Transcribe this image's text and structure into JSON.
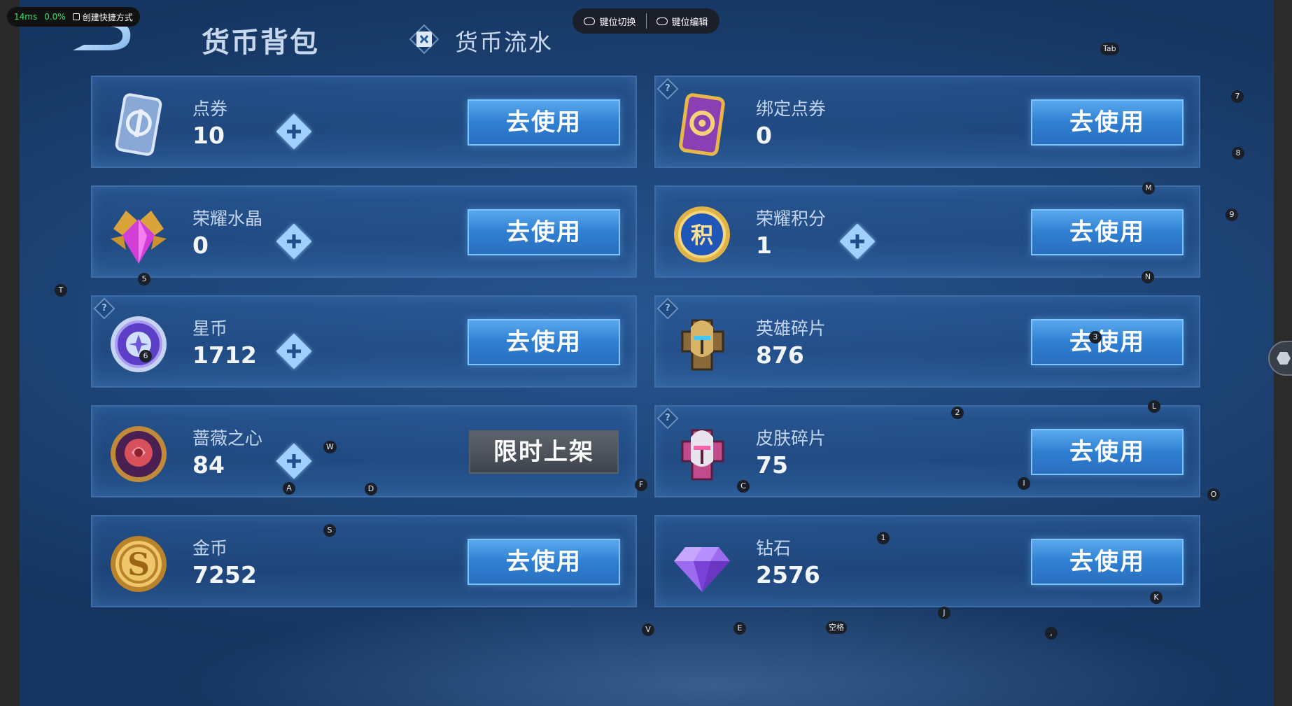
{
  "status_bar": {
    "ping": "14ms",
    "cpu": "0.0%",
    "shortcut_label": "创建快捷方式"
  },
  "key_toolbar": {
    "switch_label": "键位切换",
    "edit_label": "键位编辑"
  },
  "header": {
    "title": "货币背包",
    "flow_tab": "货币流水"
  },
  "colors": {
    "accent": "#2f7fd2",
    "panel": "#1d4476",
    "text_light": "#c4d5ee"
  },
  "currencies": [
    {
      "name": "点券",
      "amount": "10",
      "icon": "ticket-icon",
      "plus": true,
      "help": false,
      "action": "去使用",
      "action_type": "use"
    },
    {
      "name": "绑定点券",
      "amount": "0",
      "icon": "bound-ticket-icon",
      "plus": false,
      "help": true,
      "action": "去使用",
      "action_type": "use"
    },
    {
      "name": "荣耀水晶",
      "amount": "0",
      "icon": "glory-crystal-icon",
      "plus": true,
      "help": false,
      "action": "去使用",
      "action_type": "use"
    },
    {
      "name": "荣耀积分",
      "amount": "1",
      "icon": "glory-points-icon",
      "plus": true,
      "help": false,
      "action": "去使用",
      "action_type": "use"
    },
    {
      "name": "星币",
      "amount": "1712",
      "icon": "star-coin-icon",
      "plus": true,
      "help": true,
      "action": "去使用",
      "action_type": "use"
    },
    {
      "name": "英雄碎片",
      "amount": "876",
      "icon": "hero-shard-icon",
      "plus": false,
      "help": true,
      "action": "去使用",
      "action_type": "use"
    },
    {
      "name": "蔷薇之心",
      "amount": "84",
      "icon": "rose-heart-icon",
      "plus": true,
      "help": false,
      "action": "限时上架",
      "action_type": "limited"
    },
    {
      "name": "皮肤碎片",
      "amount": "75",
      "icon": "skin-shard-icon",
      "plus": false,
      "help": true,
      "action": "去使用",
      "action_type": "use"
    },
    {
      "name": "金币",
      "amount": "7252",
      "icon": "gold-coin-icon",
      "plus": false,
      "help": false,
      "action": "去使用",
      "action_type": "use"
    },
    {
      "name": "钻石",
      "amount": "2576",
      "icon": "diamond-icon",
      "plus": false,
      "help": false,
      "action": "去使用",
      "action_type": "use"
    }
  ],
  "key_hints": {
    "tab": "Tab",
    "k7": "7",
    "k8": "8",
    "m": "M",
    "k9": "9",
    "t": "T",
    "k5": "5",
    "n": "N",
    "k6": "6",
    "k3": "3",
    "k2": "2",
    "l": "L",
    "w": "W",
    "a": "A",
    "d": "D",
    "f": "F",
    "c": "C",
    "i": "I",
    "o": "O",
    "s": "S",
    "k1": "1",
    "k": "K",
    "j": "J",
    "v": "V",
    "e": "E",
    "space": "空格",
    "comma": ","
  }
}
